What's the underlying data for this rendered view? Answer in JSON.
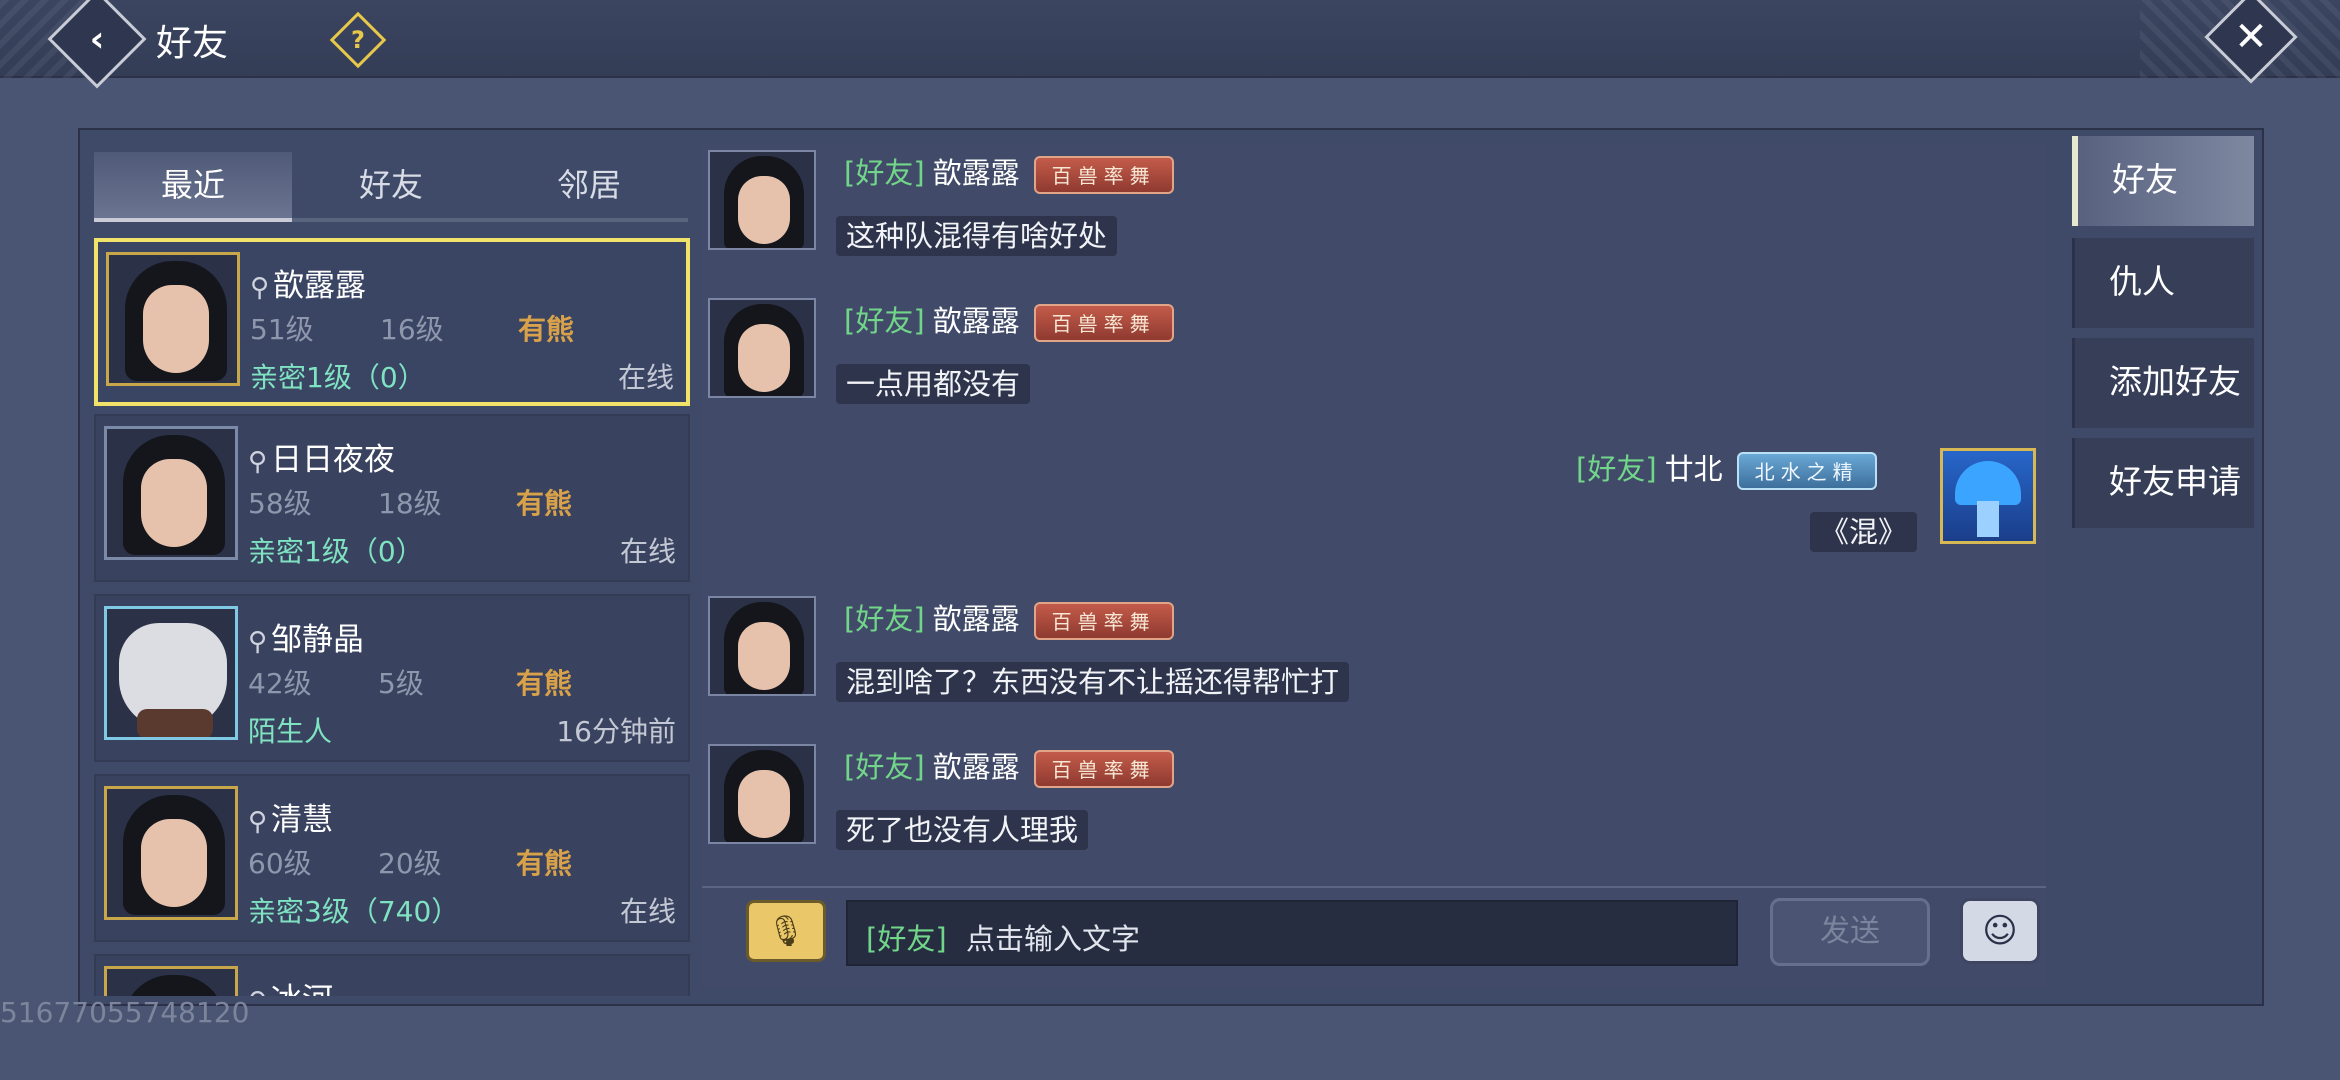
{
  "header": {
    "title": "好友",
    "back_icon": "back-arrow-icon",
    "help_icon": "question-icon",
    "close_icon": "close-icon"
  },
  "list_tabs": [
    "最近",
    "好友",
    "邻居"
  ],
  "friends": [
    {
      "name": "歆露露",
      "level": "51级",
      "home_level": "16级",
      "bear": "有熊",
      "relation": "亲密1级（0）",
      "status": "在线"
    },
    {
      "name": "日日夜夜",
      "level": "58级",
      "home_level": "18级",
      "bear": "有熊",
      "relation": "亲密1级（0）",
      "status": "在线"
    },
    {
      "name": "邹静晶",
      "level": "42级",
      "home_level": "5级",
      "bear": "有熊",
      "relation": "陌生人",
      "status": "16分钟前"
    },
    {
      "name": "清慧",
      "level": "60级",
      "home_level": "20级",
      "bear": "有熊",
      "relation": "亲密3级（740）",
      "status": "在线"
    },
    {
      "name": "冰河"
    }
  ],
  "messages": [
    {
      "channel": "[好友]",
      "sender": "歆露露",
      "badge": "百兽率舞",
      "text": "这种队混得有啥好处"
    },
    {
      "channel": "[好友]",
      "sender": "歆露露",
      "badge": "百兽率舞",
      "text": "一点用都没有"
    },
    {
      "channel": "[好友]",
      "sender": "廿北",
      "badge": "北水之精",
      "text": "《混》"
    },
    {
      "channel": "[好友]",
      "sender": "歆露露",
      "badge": "百兽率舞",
      "text": "混到啥了？东西没有不让摇还得帮忙打"
    },
    {
      "channel": "[好友]",
      "sender": "歆露露",
      "badge": "百兽率舞",
      "text": "死了也没有人理我"
    }
  ],
  "input": {
    "channel": "[好友]",
    "placeholder": "点击输入文字",
    "send_label": "发送"
  },
  "side_tabs": [
    "好友",
    "仇人",
    "添加好友",
    "好友申请"
  ],
  "watermark": "51677055748120",
  "colors": {
    "background": "#4a5573",
    "channel_green": "#72d68a",
    "intimacy_green": "#7fe3c2",
    "selected_border": "#f1e36a",
    "bear_gold": "#d9a24a"
  }
}
